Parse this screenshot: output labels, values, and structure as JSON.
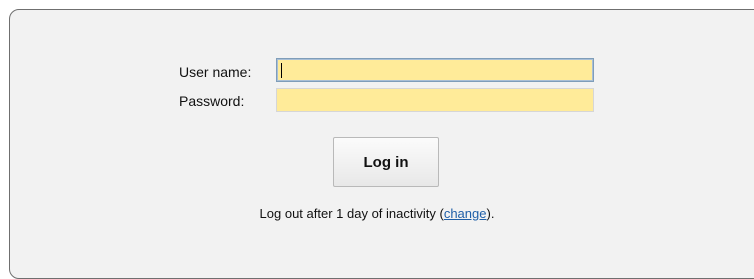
{
  "login_form": {
    "username_label": "User name:",
    "username_value": "",
    "password_label": "Password:",
    "password_value": "",
    "login_button_label": "Log in",
    "inactivity_text_before": "Log out after 1 day of inactivity (",
    "inactivity_link": "change",
    "inactivity_text_after": ")."
  },
  "colors": {
    "field_background": "#ffeb99",
    "panel_background": "#f2f2f2",
    "link": "#1f5fa8"
  }
}
